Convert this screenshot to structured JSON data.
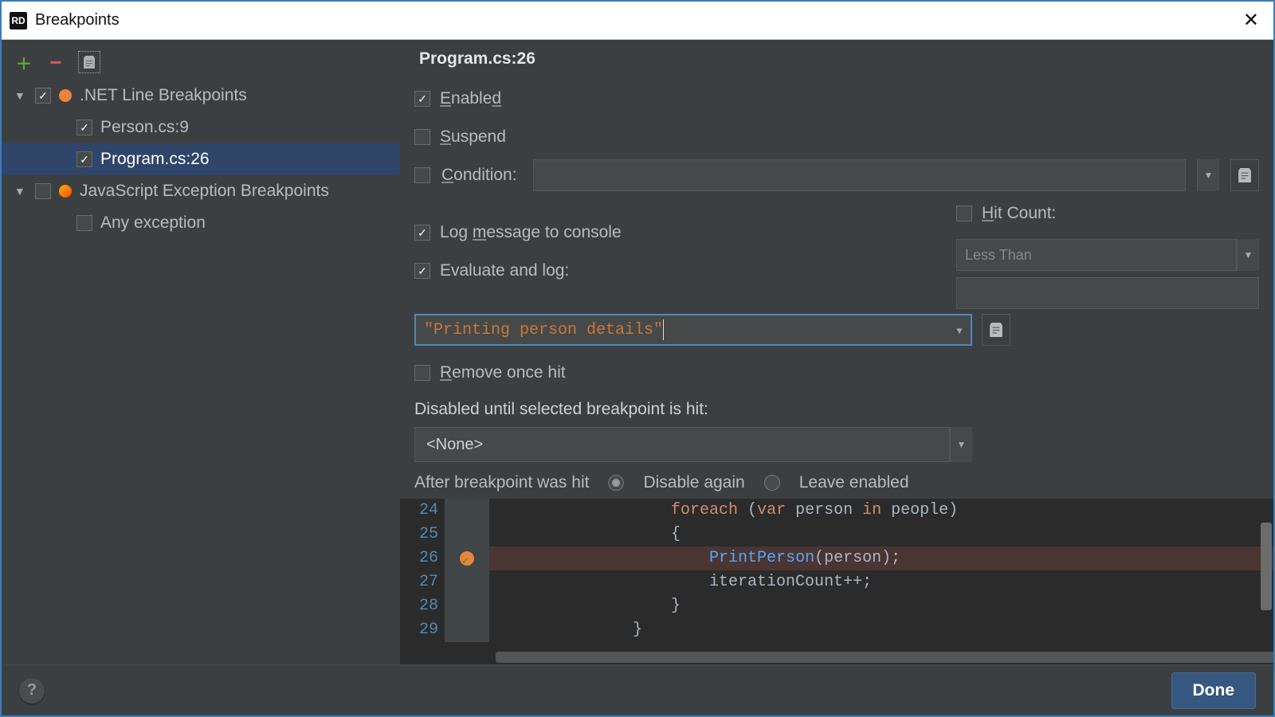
{
  "window": {
    "title": "Breakpoints",
    "app_icon_text": "RD"
  },
  "tree": {
    "groups": [
      {
        "label": ".NET Line Breakpoints",
        "checked": true,
        "expanded": true,
        "icon": "bp-dot",
        "items": [
          {
            "label": "Person.cs:9",
            "checked": true,
            "selected": false
          },
          {
            "label": "Program.cs:26",
            "checked": true,
            "selected": true
          }
        ]
      },
      {
        "label": "JavaScript Exception Breakpoints",
        "checked": false,
        "expanded": true,
        "icon": "ex-dot",
        "items": [
          {
            "label": "Any exception",
            "checked": false,
            "selected": false
          }
        ]
      }
    ]
  },
  "detail": {
    "title": "Program.cs:26",
    "enabled_label": "Enabled",
    "suspend_label": "Suspend",
    "condition_label": "Condition:",
    "condition_value": "",
    "log_label": "Log message to console",
    "evaluate_label": "Evaluate and log:",
    "evaluate_value": "\"Printing person details\"",
    "remove_label": "Remove once hit",
    "disabled_until_label": "Disabled until selected breakpoint is hit:",
    "disabled_until_value": "<None>",
    "after_hit_label": "After breakpoint was hit",
    "after_hit_options": {
      "disable_again": "Disable again",
      "leave_enabled": "Leave enabled"
    },
    "after_hit_selected": "disable_again",
    "hit_count_label": "Hit Count:",
    "hit_count_op": "Less Than",
    "hit_count_value": "",
    "enabled": true,
    "suspend": false,
    "condition_on": false,
    "log_on": true,
    "evaluate_on": true,
    "remove_on": false,
    "hit_count_on": false
  },
  "code": {
    "lines": [
      {
        "n": 24,
        "indent": 4,
        "tokens": [
          [
            "kw",
            "foreach"
          ],
          [
            "",
            " ("
          ],
          [
            "kw",
            "var"
          ],
          [
            "",
            " person "
          ],
          [
            "kw",
            "in"
          ],
          [
            "",
            " people)"
          ]
        ]
      },
      {
        "n": 25,
        "indent": 4,
        "tokens": [
          [
            "",
            "{"
          ]
        ]
      },
      {
        "n": 26,
        "indent": 5,
        "hl": true,
        "bp": true,
        "tokens": [
          [
            "fn",
            "PrintPerson"
          ],
          [
            "",
            "(person);"
          ]
        ]
      },
      {
        "n": 27,
        "indent": 5,
        "tokens": [
          [
            "",
            "iterationCount++;"
          ]
        ]
      },
      {
        "n": 28,
        "indent": 4,
        "tokens": [
          [
            "",
            "}"
          ]
        ]
      },
      {
        "n": 29,
        "indent": 3,
        "tokens": [
          [
            "",
            "}"
          ]
        ]
      }
    ]
  },
  "buttons": {
    "done": "Done"
  }
}
